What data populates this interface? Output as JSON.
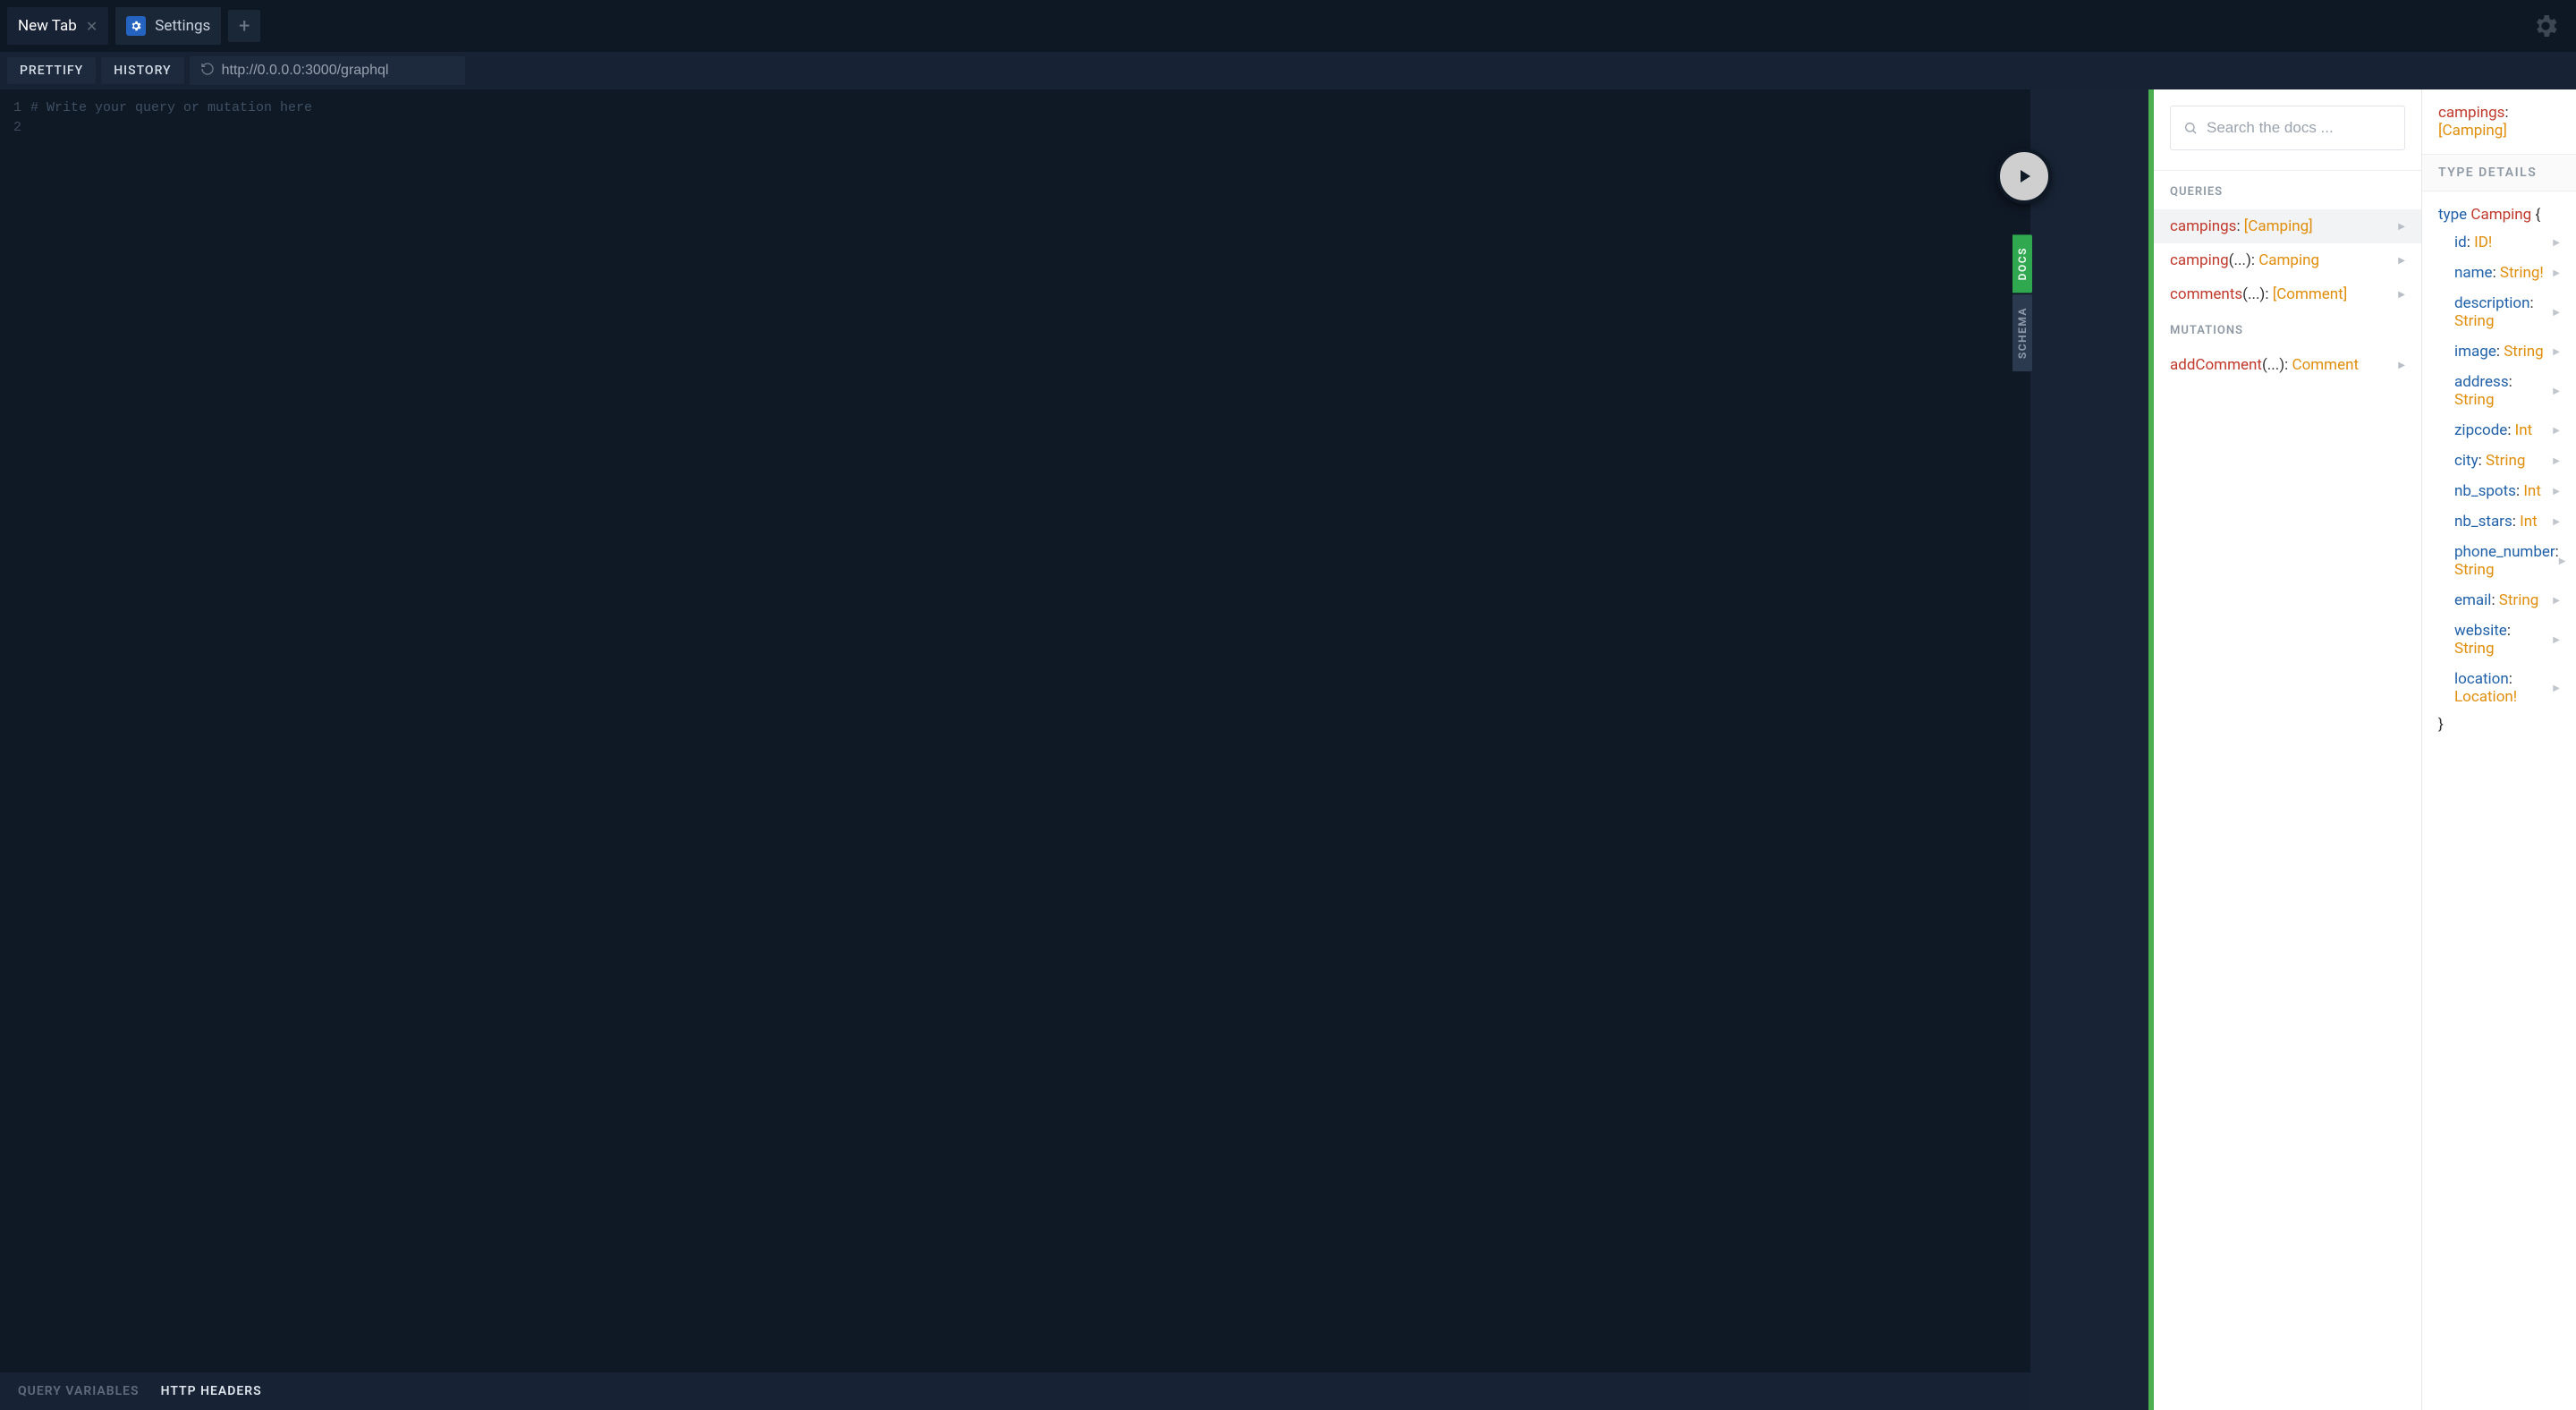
{
  "tabs": {
    "newtab_label": "New Tab",
    "settings_label": "Settings"
  },
  "toolbar": {
    "prettify": "PRETTIFY",
    "history": "HISTORY",
    "url": "http://0.0.0.0:3000/graphql"
  },
  "editor": {
    "line1": "1",
    "line2": "2",
    "placeholder_comment": "# Write your query or mutation here"
  },
  "bottom_tabs": {
    "query_variables": "QUERY VARIABLES",
    "http_headers": "HTTP HEADERS"
  },
  "sidetabs": {
    "docs": "DOCS",
    "schema": "SCHEMA"
  },
  "docs": {
    "search_placeholder": "Search the docs ...",
    "queries_heading": "QUERIES",
    "mutations_heading": "MUTATIONS",
    "queries": [
      {
        "name": "campings",
        "args": "",
        "return": "[Camping]"
      },
      {
        "name": "camping",
        "args": "(...)",
        "return": "Camping"
      },
      {
        "name": "comments",
        "args": "(...)",
        "return": "[Comment]"
      }
    ],
    "mutations": [
      {
        "name": "addComment",
        "args": "(...)",
        "return": "Comment"
      }
    ]
  },
  "type_details": {
    "breadcrumb_field": "campings",
    "breadcrumb_return": "[Camping]",
    "heading": "TYPE DETAILS",
    "type_keyword": "type",
    "type_name": "Camping",
    "open_brace": "{",
    "close_brace": "}",
    "fields": [
      {
        "name": "id",
        "type": "ID!"
      },
      {
        "name": "name",
        "type": "String!"
      },
      {
        "name": "description",
        "type": "String"
      },
      {
        "name": "image",
        "type": "String"
      },
      {
        "name": "address",
        "type": "String"
      },
      {
        "name": "zipcode",
        "type": "Int"
      },
      {
        "name": "city",
        "type": "String"
      },
      {
        "name": "nb_spots",
        "type": "Int"
      },
      {
        "name": "nb_stars",
        "type": "Int"
      },
      {
        "name": "phone_number",
        "type": "String"
      },
      {
        "name": "email",
        "type": "String"
      },
      {
        "name": "website",
        "type": "String"
      },
      {
        "name": "location",
        "type": "Location!"
      }
    ]
  }
}
